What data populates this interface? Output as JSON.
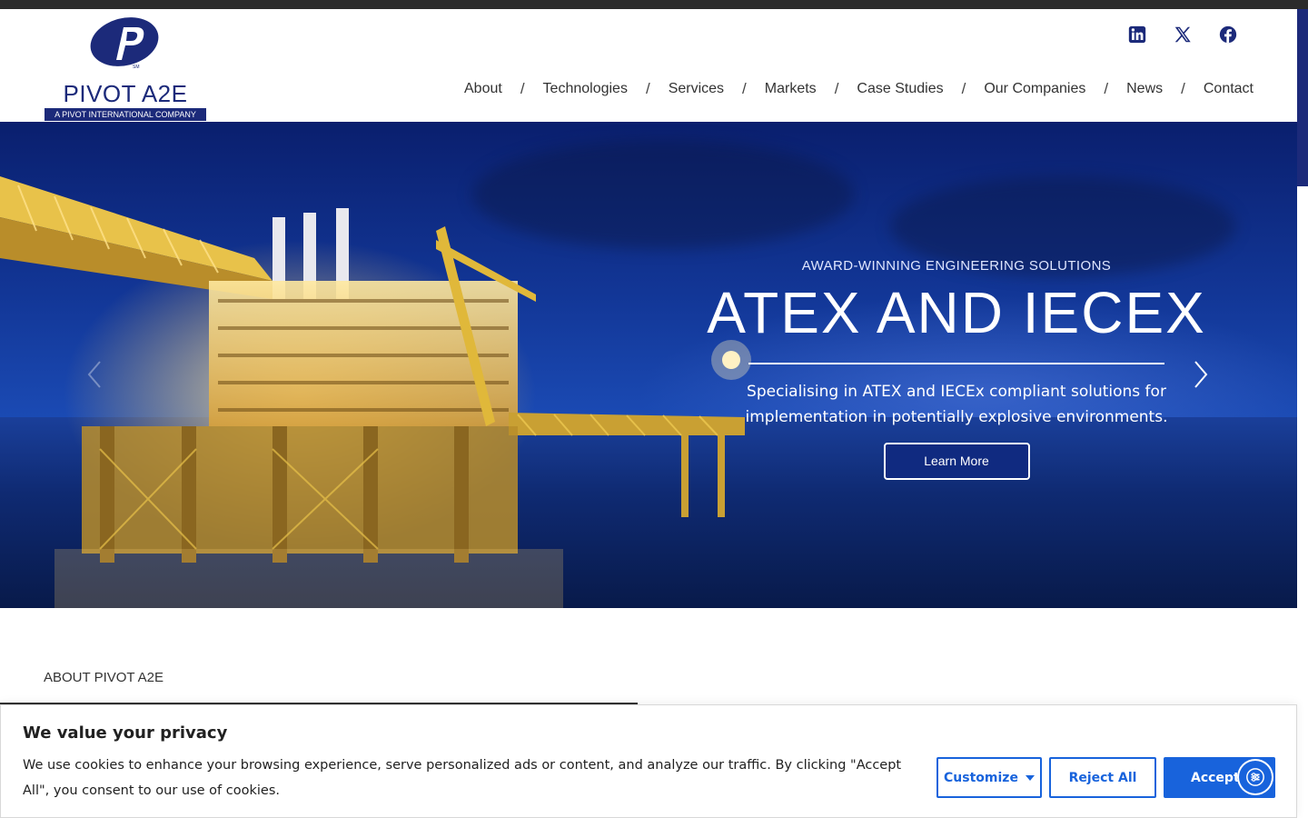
{
  "brand": {
    "name": "PIVOT A2E",
    "tagline": "A PIVOT INTERNATIONAL COMPANY",
    "color": "#1c2a7a"
  },
  "social": [
    {
      "name": "linkedin-icon"
    },
    {
      "name": "x-icon"
    },
    {
      "name": "facebook-icon"
    }
  ],
  "nav": {
    "items": [
      "About",
      "Technologies",
      "Services",
      "Markets",
      "Case Studies",
      "Our Companies",
      "News",
      "Contact"
    ],
    "separator": "/"
  },
  "hero": {
    "kicker": "AWARD-WINNING ENGINEERING SOLUTIONS",
    "title": "ATEX AND IECEX",
    "description": "Specialising in ATEX and IECEx compliant solutions for implementation in potentially explosive environments.",
    "cta": "Learn More"
  },
  "about": {
    "label": "ABOUT PIVOT A2E"
  },
  "cookie_banner": {
    "title": "We value your privacy",
    "text": "We use cookies to enhance your browsing experience, serve personalized ads or content, and analyze our traffic. By clicking \"Accept All\", you consent to our use of cookies.",
    "customize": "Customize",
    "reject": "Reject All",
    "accept": "Accept All",
    "accent": "#1863dc"
  }
}
